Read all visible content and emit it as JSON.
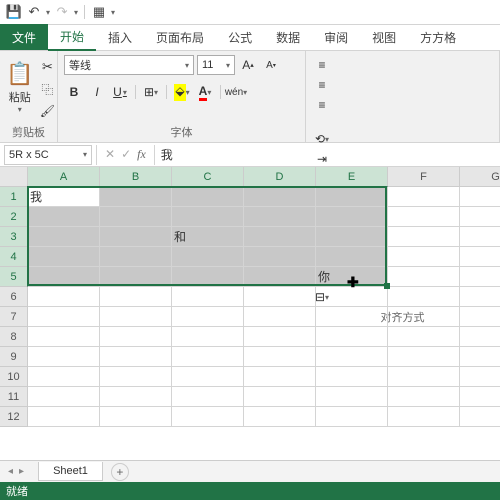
{
  "qat": {
    "save": "💾"
  },
  "tabs": {
    "file": "文件",
    "home": "开始",
    "insert": "插入",
    "layout": "页面布局",
    "formulas": "公式",
    "data": "数据",
    "review": "审阅",
    "view": "视图",
    "extra": "方方格"
  },
  "ribbon": {
    "clipboard": {
      "paste": "粘贴",
      "label": "剪贴板"
    },
    "font": {
      "name": "等线",
      "size": "11",
      "label": "字体",
      "bold": "B",
      "italic": "I",
      "underline": "U",
      "wen": "wén"
    },
    "align": {
      "label": "对齐方式"
    }
  },
  "formula_bar": {
    "name_box": "5R x 5C",
    "value": "我"
  },
  "grid": {
    "cols": [
      "A",
      "B",
      "C",
      "D",
      "E",
      "F",
      "G"
    ],
    "rows": [
      "1",
      "2",
      "3",
      "4",
      "5",
      "6",
      "7",
      "8",
      "9",
      "10",
      "11",
      "12"
    ],
    "selected_cols": [
      0,
      1,
      2,
      3,
      4
    ],
    "selected_rows": [
      0,
      1,
      2,
      3,
      4
    ],
    "active": {
      "r": 0,
      "c": 0
    },
    "cells": {
      "0_0": "我",
      "2_2": "和",
      "4_4": "你"
    }
  },
  "sheet": {
    "tab1": "Sheet1"
  },
  "status": {
    "ready": "就绪"
  }
}
